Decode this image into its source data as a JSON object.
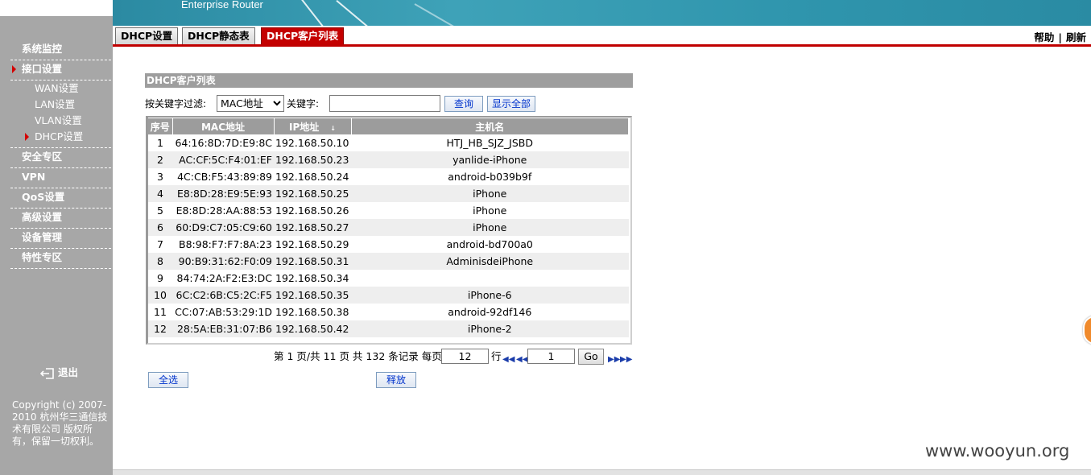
{
  "banner": {
    "product": "Enterprise Router"
  },
  "tabs": [
    {
      "label": "DHCP设置",
      "active": false
    },
    {
      "label": "DHCP静态表",
      "active": false
    },
    {
      "label": "DHCP客户列表",
      "active": true
    }
  ],
  "toplinks": {
    "help": "帮助",
    "sep": "|",
    "refresh": "刷新"
  },
  "sidebar": {
    "items": [
      {
        "label": "系统监控"
      },
      {
        "label": "接口设置",
        "expanded": true,
        "children": [
          {
            "label": "WAN设置"
          },
          {
            "label": "LAN设置"
          },
          {
            "label": "VLAN设置"
          },
          {
            "label": "DHCP设置",
            "selected": true
          }
        ]
      },
      {
        "label": "安全专区"
      },
      {
        "label": "VPN"
      },
      {
        "label": "QoS设置"
      },
      {
        "label": "高级设置"
      },
      {
        "label": "设备管理"
      },
      {
        "label": "特性专区"
      }
    ],
    "logout": "退出",
    "copyright": "Copyright (c) 2007-2010 杭州华三通信技术有限公司 版权所有，保留一切权利。"
  },
  "main": {
    "title": "DHCP客户列表",
    "filter": {
      "label": "按关键字过滤:",
      "select_value": "MAC地址",
      "keyword_label": "关键字:",
      "keyword_value": "",
      "query_button": "查询",
      "show_all_button": "显示全部"
    },
    "table": {
      "columns": [
        "序号",
        "MAC地址",
        "IP地址",
        "主机名"
      ],
      "rows": [
        {
          "no": "1",
          "mac": "64:16:8D:7D:E9:8C",
          "ip": "192.168.50.10",
          "host": "HTJ_HB_SJZ_JSBD"
        },
        {
          "no": "2",
          "mac": "AC:CF:5C:F4:01:EF",
          "ip": "192.168.50.23",
          "host": "yanlide-iPhone"
        },
        {
          "no": "3",
          "mac": "4C:CB:F5:43:89:89",
          "ip": "192.168.50.24",
          "host": "android-b039b9f"
        },
        {
          "no": "4",
          "mac": "E8:8D:28:E9:5E:93",
          "ip": "192.168.50.25",
          "host": "iPhone"
        },
        {
          "no": "5",
          "mac": "E8:8D:28:AA:88:53",
          "ip": "192.168.50.26",
          "host": "iPhone"
        },
        {
          "no": "6",
          "mac": "60:D9:C7:05:C9:60",
          "ip": "192.168.50.27",
          "host": "iPhone"
        },
        {
          "no": "7",
          "mac": "B8:98:F7:F7:8A:23",
          "ip": "192.168.50.29",
          "host": "android-bd700a0"
        },
        {
          "no": "8",
          "mac": "90:B9:31:62:F0:09",
          "ip": "192.168.50.31",
          "host": "AdminisdeiPhone"
        },
        {
          "no": "9",
          "mac": "84:74:2A:F2:E3:DC",
          "ip": "192.168.50.34",
          "host": ""
        },
        {
          "no": "10",
          "mac": "6C:C2:6B:C5:2C:F5",
          "ip": "192.168.50.35",
          "host": "iPhone-6"
        },
        {
          "no": "11",
          "mac": "CC:07:AB:53:29:1D",
          "ip": "192.168.50.38",
          "host": "android-92df146"
        },
        {
          "no": "12",
          "mac": "28:5A:EB:31:07:B6",
          "ip": "192.168.50.42",
          "host": "iPhone-2"
        }
      ]
    },
    "pager": {
      "summary": "第 1 页/共 11 页 共 132 条记录 每页",
      "per_page": "12",
      "per_page_unit": "行",
      "page_input": "1",
      "go": "Go"
    },
    "select_all_button": "全选",
    "release_button": "释放"
  },
  "watermark": "www.wooyun.org",
  "colors": {
    "accent": "#c40000",
    "sidebar": "#a7a7a7",
    "banner": "#3ea2b8",
    "header_gray": "#9c9c9c"
  }
}
